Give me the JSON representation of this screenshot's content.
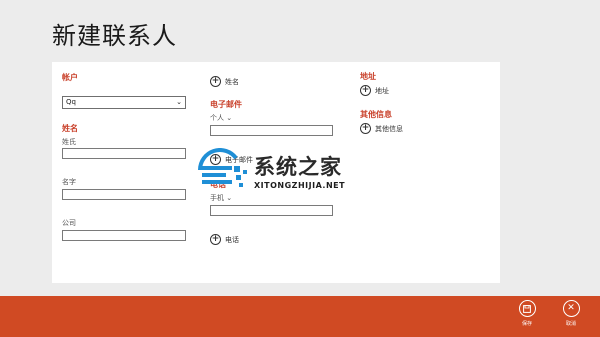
{
  "page": {
    "title": "新建联系人"
  },
  "account": {
    "label": "帐户",
    "selected": "Qq"
  },
  "name_section": {
    "label": "姓名",
    "fields": [
      {
        "label": "姓氏",
        "value": ""
      },
      {
        "label": "名字",
        "value": ""
      },
      {
        "label": "公司",
        "value": ""
      }
    ]
  },
  "column2": {
    "add_name": "姓名",
    "email_label": "电子邮件",
    "email_type": "个人",
    "add_email": "电子邮件",
    "phone_label": "电话",
    "phone_type": "手机",
    "add_phone": "电话"
  },
  "column3": {
    "address_label": "地址",
    "add_address": "地址",
    "other_label": "其他信息",
    "add_other": "其他信息"
  },
  "appbar": {
    "save_label": "保存",
    "cancel_label": "取消"
  },
  "watermark": {
    "title": "系统之家",
    "subtitle": "XITONGZHIJIA.NET"
  }
}
